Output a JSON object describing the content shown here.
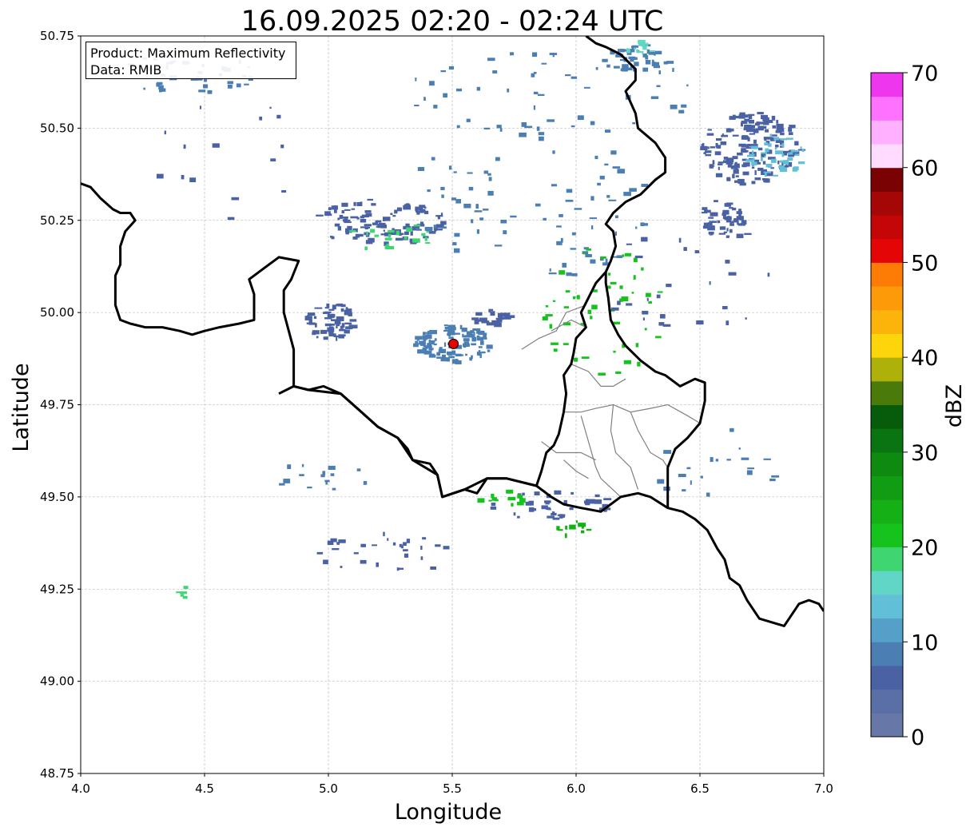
{
  "title": "16.09.2025 02:20 - 02:24 UTC",
  "info": {
    "product": "Product: Maximum Reflectivity",
    "data_source": "Data: RMIB"
  },
  "colorbar": {
    "label": "dBZ",
    "ticks": [
      "0",
      "10",
      "20",
      "30",
      "40",
      "50",
      "60",
      "70"
    ],
    "min": 0,
    "max": 70,
    "colors": [
      "#6677a8",
      "#5a6fa6",
      "#4a62a4",
      "#4b7fb3",
      "#55a0c8",
      "#62bfd8",
      "#62d6c6",
      "#3fd672",
      "#15c31c",
      "#14b016",
      "#119d13",
      "#0e8a10",
      "#0a7410",
      "#075c0b",
      "#4a7a0a",
      "#adb10a",
      "#fcd60a",
      "#fcb40a",
      "#fc9a0a",
      "#fc7c05",
      "#e40606",
      "#c40606",
      "#a50606",
      "#7a0202",
      "#ffdcff",
      "#ffb0ff",
      "#ff72ff",
      "#ef36ef"
    ]
  },
  "chart_data": {
    "type": "map",
    "xlabel": "Longitude",
    "ylabel": "Latitude",
    "xlim": [
      4.0,
      7.0
    ],
    "ylim": [
      48.75,
      50.75
    ],
    "xticks": [
      "4.0",
      "4.5",
      "5.0",
      "5.5",
      "6.0",
      "6.5",
      "7.0"
    ],
    "yticks": [
      "48.75",
      "49.00",
      "49.25",
      "49.50",
      "49.75",
      "50.00",
      "50.25",
      "50.50",
      "50.75"
    ],
    "grid": true,
    "radar_site": {
      "lon": 5.505,
      "lat": 49.915,
      "color": "#e60000"
    },
    "echo_clusters": [
      {
        "lon": 6.7,
        "lat": 50.45,
        "rlon": 0.2,
        "rlat": 0.1,
        "n": 160,
        "color": "#4a62a4"
      },
      {
        "lon": 6.8,
        "lat": 50.43,
        "rlon": 0.12,
        "rlat": 0.06,
        "n": 40,
        "color": "#62bfd8"
      },
      {
        "lon": 6.58,
        "lat": 50.26,
        "rlon": 0.09,
        "rlat": 0.05,
        "n": 45,
        "color": "#4a62a4"
      },
      {
        "lon": 6.25,
        "lat": 50.69,
        "rlon": 0.12,
        "rlat": 0.04,
        "n": 40,
        "color": "#4b7fb3"
      },
      {
        "lon": 6.25,
        "lat": 50.72,
        "rlon": 0.06,
        "rlat": 0.02,
        "n": 12,
        "color": "#62d6c6"
      },
      {
        "lon": 5.2,
        "lat": 50.25,
        "rlon": 0.28,
        "rlat": 0.06,
        "n": 110,
        "color": "#4a62a4"
      },
      {
        "lon": 5.25,
        "lat": 50.21,
        "rlon": 0.18,
        "rlat": 0.04,
        "n": 20,
        "color": "#3fd672"
      },
      {
        "lon": 5.5,
        "lat": 49.92,
        "rlon": 0.16,
        "rlat": 0.05,
        "n": 110,
        "color": "#4b7fb3"
      },
      {
        "lon": 5.0,
        "lat": 49.98,
        "rlon": 0.1,
        "rlat": 0.05,
        "n": 60,
        "color": "#4a62a4"
      },
      {
        "lon": 5.65,
        "lat": 49.99,
        "rlon": 0.08,
        "rlat": 0.02,
        "n": 25,
        "color": "#4a62a4"
      },
      {
        "lon": 5.8,
        "lat": 50.3,
        "rlon": 0.5,
        "rlat": 0.22,
        "n": 90,
        "color": "#4b7fb3"
      },
      {
        "lon": 5.9,
        "lat": 50.6,
        "rlon": 0.6,
        "rlat": 0.12,
        "n": 50,
        "color": "#4b7fb3"
      },
      {
        "lon": 6.1,
        "lat": 50.0,
        "rlon": 0.25,
        "rlat": 0.18,
        "n": 50,
        "color": "#15c31c"
      },
      {
        "lon": 5.9,
        "lat": 49.48,
        "rlon": 0.25,
        "rlat": 0.04,
        "n": 40,
        "color": "#4a62a4"
      },
      {
        "lon": 5.98,
        "lat": 49.42,
        "rlon": 0.08,
        "rlat": 0.02,
        "n": 10,
        "color": "#14b016"
      },
      {
        "lon": 5.7,
        "lat": 49.5,
        "rlon": 0.1,
        "rlat": 0.02,
        "n": 12,
        "color": "#15c31c"
      },
      {
        "lon": 4.4,
        "lat": 50.65,
        "rlon": 0.35,
        "rlat": 0.06,
        "n": 35,
        "color": "#4b7fb3"
      },
      {
        "lon": 4.6,
        "lat": 50.4,
        "rlon": 0.3,
        "rlat": 0.2,
        "n": 15,
        "color": "#4a62a4"
      },
      {
        "lon": 4.95,
        "lat": 49.55,
        "rlon": 0.2,
        "rlat": 0.05,
        "n": 15,
        "color": "#4b7fb3"
      },
      {
        "lon": 5.2,
        "lat": 49.35,
        "rlon": 0.3,
        "rlat": 0.06,
        "n": 30,
        "color": "#4a62a4"
      },
      {
        "lon": 6.55,
        "lat": 49.6,
        "rlon": 0.3,
        "rlat": 0.1,
        "n": 20,
        "color": "#4b7fb3"
      },
      {
        "lon": 6.45,
        "lat": 50.1,
        "rlon": 0.4,
        "rlat": 0.15,
        "n": 30,
        "color": "#4a62a4"
      },
      {
        "lon": 4.4,
        "lat": 49.24,
        "rlon": 0.05,
        "rlat": 0.02,
        "n": 6,
        "color": "#3fd672"
      }
    ],
    "belgium_border": [
      [
        4.0,
        50.35
      ],
      [
        4.04,
        50.34
      ],
      [
        4.08,
        50.31
      ],
      [
        4.13,
        50.28
      ],
      [
        4.16,
        50.27
      ],
      [
        4.2,
        50.27
      ],
      [
        4.22,
        50.25
      ],
      [
        4.18,
        50.22
      ],
      [
        4.16,
        50.18
      ],
      [
        4.16,
        50.13
      ],
      [
        4.14,
        50.1
      ],
      [
        4.14,
        50.05
      ],
      [
        4.14,
        50.02
      ],
      [
        4.16,
        49.98
      ],
      [
        4.2,
        49.97
      ],
      [
        4.26,
        49.96
      ],
      [
        4.33,
        49.96
      ],
      [
        4.4,
        49.95
      ],
      [
        4.45,
        49.94
      ],
      [
        4.5,
        49.95
      ],
      [
        4.56,
        49.96
      ],
      [
        4.64,
        49.97
      ],
      [
        4.7,
        49.98
      ],
      [
        4.7,
        50.05
      ],
      [
        4.68,
        50.09
      ],
      [
        4.74,
        50.12
      ],
      [
        4.8,
        50.15
      ],
      [
        4.88,
        50.14
      ],
      [
        4.85,
        50.09
      ],
      [
        4.82,
        50.06
      ],
      [
        4.82,
        50.0
      ],
      [
        4.84,
        49.95
      ],
      [
        4.86,
        49.9
      ],
      [
        4.86,
        49.85
      ],
      [
        4.86,
        49.8
      ],
      [
        4.92,
        49.79
      ],
      [
        4.98,
        49.8
      ],
      [
        5.05,
        49.78
      ],
      [
        5.1,
        49.75
      ],
      [
        5.15,
        49.72
      ],
      [
        5.2,
        49.69
      ],
      [
        5.28,
        49.66
      ],
      [
        5.32,
        49.63
      ],
      [
        5.34,
        49.6
      ],
      [
        5.41,
        49.59
      ],
      [
        5.44,
        49.56
      ],
      [
        5.46,
        49.5
      ],
      [
        5.55,
        49.52
      ],
      [
        5.6,
        49.51
      ],
      [
        5.64,
        49.55
      ],
      [
        5.72,
        49.55
      ],
      [
        5.78,
        49.54
      ],
      [
        5.84,
        49.53
      ],
      [
        5.86,
        49.57
      ],
      [
        5.88,
        49.62
      ],
      [
        5.91,
        49.64
      ],
      [
        5.93,
        49.67
      ],
      [
        5.95,
        49.73
      ],
      [
        5.96,
        49.78
      ],
      [
        5.95,
        49.83
      ],
      [
        5.98,
        49.86
      ],
      [
        5.99,
        49.89
      ],
      [
        6.0,
        49.93
      ],
      [
        6.04,
        49.96
      ],
      [
        6.02,
        50.0
      ],
      [
        6.05,
        50.04
      ],
      [
        6.08,
        50.08
      ],
      [
        6.12,
        50.11
      ],
      [
        6.14,
        50.14
      ],
      [
        6.16,
        50.18
      ],
      [
        6.15,
        50.22
      ],
      [
        6.12,
        50.24
      ],
      [
        6.15,
        50.27
      ],
      [
        6.2,
        50.3
      ],
      [
        6.26,
        50.32
      ],
      [
        6.32,
        50.36
      ],
      [
        6.36,
        50.38
      ],
      [
        6.36,
        50.42
      ],
      [
        6.32,
        50.46
      ],
      [
        6.25,
        50.5
      ],
      [
        6.24,
        50.54
      ],
      [
        6.22,
        50.57
      ],
      [
        6.2,
        50.6
      ],
      [
        6.24,
        50.63
      ],
      [
        6.24,
        50.66
      ],
      [
        6.18,
        50.7
      ],
      [
        6.12,
        50.72
      ],
      [
        6.08,
        50.73
      ],
      [
        6.04,
        50.75
      ]
    ],
    "france_border": [
      [
        4.8,
        49.78
      ],
      [
        4.86,
        49.8
      ],
      [
        4.92,
        49.79
      ],
      [
        5.05,
        49.78
      ],
      [
        5.1,
        49.75
      ],
      [
        5.2,
        49.69
      ],
      [
        5.28,
        49.66
      ],
      [
        5.34,
        49.6
      ],
      [
        5.44,
        49.56
      ],
      [
        5.46,
        49.5
      ],
      [
        5.55,
        49.52
      ],
      [
        5.64,
        49.55
      ],
      [
        5.72,
        49.55
      ],
      [
        5.84,
        49.53
      ],
      [
        5.9,
        49.5
      ],
      [
        5.95,
        49.48
      ],
      [
        6.02,
        49.47
      ],
      [
        6.1,
        49.46
      ],
      [
        6.18,
        49.5
      ],
      [
        6.25,
        49.51
      ],
      [
        6.3,
        49.5
      ],
      [
        6.37,
        49.47
      ],
      [
        6.43,
        49.46
      ],
      [
        6.48,
        49.44
      ],
      [
        6.53,
        49.41
      ],
      [
        6.57,
        49.36
      ],
      [
        6.6,
        49.33
      ],
      [
        6.62,
        49.28
      ],
      [
        6.66,
        49.26
      ],
      [
        6.69,
        49.22
      ],
      [
        6.74,
        49.17
      ],
      [
        6.79,
        49.16
      ],
      [
        6.84,
        49.15
      ],
      [
        6.86,
        49.17
      ],
      [
        6.9,
        49.21
      ],
      [
        6.94,
        49.22
      ],
      [
        6.98,
        49.21
      ],
      [
        7.0,
        49.19
      ]
    ],
    "germany_border": [
      [
        6.37,
        49.47
      ],
      [
        6.37,
        49.53
      ],
      [
        6.37,
        49.58
      ],
      [
        6.4,
        49.63
      ],
      [
        6.45,
        49.66
      ],
      [
        6.5,
        49.7
      ],
      [
        6.52,
        49.76
      ],
      [
        6.52,
        49.81
      ],
      [
        6.48,
        49.82
      ],
      [
        6.45,
        49.81
      ],
      [
        6.42,
        49.8
      ],
      [
        6.36,
        49.83
      ],
      [
        6.32,
        49.84
      ],
      [
        6.26,
        49.87
      ],
      [
        6.2,
        49.91
      ],
      [
        6.17,
        49.94
      ],
      [
        6.14,
        49.98
      ],
      [
        6.13,
        50.04
      ],
      [
        6.12,
        50.08
      ],
      [
        6.12,
        50.11
      ]
    ],
    "luxembourg_provinces": [
      [
        [
          5.95,
          49.73
        ],
        [
          6.02,
          49.73
        ],
        [
          6.08,
          49.74
        ],
        [
          6.15,
          49.75
        ],
        [
          6.22,
          49.73
        ],
        [
          6.3,
          49.74
        ],
        [
          6.37,
          49.75
        ],
        [
          6.45,
          49.72
        ],
        [
          6.5,
          49.7
        ]
      ],
      [
        [
          5.98,
          49.86
        ],
        [
          6.05,
          49.84
        ],
        [
          6.1,
          49.8
        ],
        [
          6.15,
          49.8
        ],
        [
          6.2,
          49.82
        ]
      ],
      [
        [
          6.02,
          49.72
        ],
        [
          6.05,
          49.65
        ],
        [
          6.08,
          49.58
        ],
        [
          6.1,
          49.55
        ],
        [
          6.18,
          49.5
        ]
      ],
      [
        [
          6.15,
          49.75
        ],
        [
          6.14,
          49.68
        ],
        [
          6.16,
          49.62
        ],
        [
          6.22,
          49.58
        ],
        [
          6.25,
          49.52
        ]
      ],
      [
        [
          6.22,
          49.73
        ],
        [
          6.25,
          49.68
        ],
        [
          6.3,
          49.62
        ],
        [
          6.35,
          49.6
        ],
        [
          6.37,
          49.58
        ]
      ],
      [
        [
          5.9,
          49.95
        ],
        [
          5.98,
          49.98
        ],
        [
          6.04,
          49.96
        ]
      ],
      [
        [
          5.86,
          49.65
        ],
        [
          5.92,
          49.62
        ],
        [
          6.02,
          49.62
        ],
        [
          6.08,
          49.6
        ]
      ],
      [
        [
          5.78,
          49.9
        ],
        [
          5.85,
          49.93
        ],
        [
          5.92,
          49.95
        ],
        [
          5.96,
          50.0
        ],
        [
          6.04,
          50.02
        ]
      ],
      [
        [
          5.95,
          49.6
        ],
        [
          6.0,
          49.57
        ],
        [
          6.05,
          49.55
        ]
      ]
    ]
  }
}
